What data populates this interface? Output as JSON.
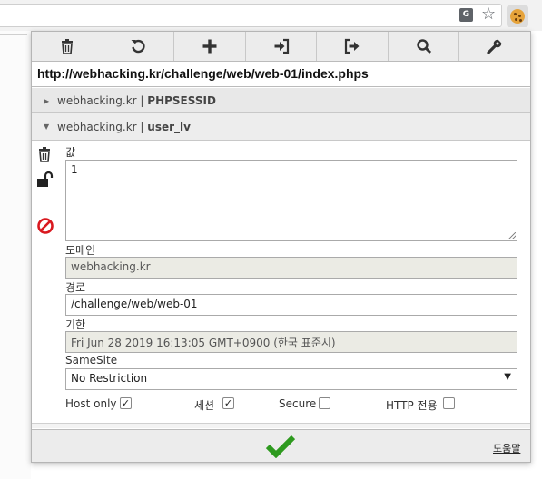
{
  "browser": {
    "translate_icon": "translate-icon",
    "translate_glyph": "G",
    "star_icon": "star-outline-icon",
    "star_glyph": "☆",
    "extension_icon": "cookie-icon"
  },
  "toolbar": {
    "buttons": [
      {
        "name": "delete-all-button",
        "icon": "trash-icon"
      },
      {
        "name": "refresh-button",
        "icon": "refresh-icon"
      },
      {
        "name": "add-cookie-button",
        "icon": "plus-icon"
      },
      {
        "name": "import-button",
        "icon": "import-icon"
      },
      {
        "name": "export-button",
        "icon": "export-icon"
      },
      {
        "name": "search-button",
        "icon": "search-icon"
      },
      {
        "name": "options-button",
        "icon": "wrench-icon"
      }
    ]
  },
  "url": "http://webhacking.kr/challenge/web/web-01/index.phps",
  "cookies": [
    {
      "domain": "webhacking.kr",
      "separator": "|",
      "name": "PHPSESSID",
      "expanded": false,
      "arrow": "▶"
    },
    {
      "domain": "webhacking.kr",
      "separator": "|",
      "name": "user_lv",
      "expanded": true,
      "arrow": "▼"
    }
  ],
  "details": {
    "value_label": "값",
    "value": "1",
    "domain_label": "도메인",
    "domain": "webhacking.kr",
    "path_label": "경로",
    "path": "/challenge/web/web-01",
    "expiration_label": "기한",
    "expiration": "Fri Jun 28 2019 16:13:05 GMT+0900 (한국 표준시)",
    "samesite_label": "SameSite",
    "samesite": "No Restriction",
    "samesite_arrow": "▼",
    "host_only_label": "Host only",
    "host_only": true,
    "session_label": "세션",
    "session": true,
    "secure_label": "Secure",
    "secure": false,
    "http_only_label": "HTTP 전용",
    "http_only": false,
    "check_mark": "✓"
  },
  "footer": {
    "save_icon": "checkmark-icon",
    "help_label": "도움말"
  },
  "colors": {
    "save_green": "#2e9a1f",
    "block_red": "#d9181f"
  }
}
